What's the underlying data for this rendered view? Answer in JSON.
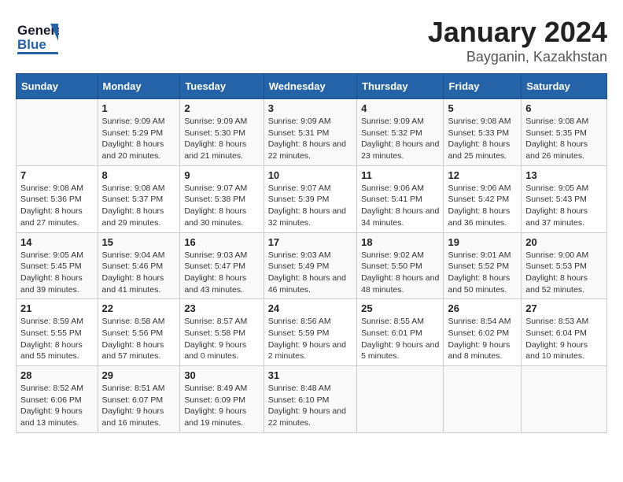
{
  "logo": {
    "line1": "General",
    "line2": "Blue"
  },
  "title": "January 2024",
  "subtitle": "Bayganin, Kazakhstan",
  "days_of_week": [
    "Sunday",
    "Monday",
    "Tuesday",
    "Wednesday",
    "Thursday",
    "Friday",
    "Saturday"
  ],
  "weeks": [
    [
      {
        "day": "",
        "sunrise": "",
        "sunset": "",
        "daylight": ""
      },
      {
        "day": "1",
        "sunrise": "Sunrise: 9:09 AM",
        "sunset": "Sunset: 5:29 PM",
        "daylight": "Daylight: 8 hours and 20 minutes."
      },
      {
        "day": "2",
        "sunrise": "Sunrise: 9:09 AM",
        "sunset": "Sunset: 5:30 PM",
        "daylight": "Daylight: 8 hours and 21 minutes."
      },
      {
        "day": "3",
        "sunrise": "Sunrise: 9:09 AM",
        "sunset": "Sunset: 5:31 PM",
        "daylight": "Daylight: 8 hours and 22 minutes."
      },
      {
        "day": "4",
        "sunrise": "Sunrise: 9:09 AM",
        "sunset": "Sunset: 5:32 PM",
        "daylight": "Daylight: 8 hours and 23 minutes."
      },
      {
        "day": "5",
        "sunrise": "Sunrise: 9:08 AM",
        "sunset": "Sunset: 5:33 PM",
        "daylight": "Daylight: 8 hours and 25 minutes."
      },
      {
        "day": "6",
        "sunrise": "Sunrise: 9:08 AM",
        "sunset": "Sunset: 5:35 PM",
        "daylight": "Daylight: 8 hours and 26 minutes."
      }
    ],
    [
      {
        "day": "7",
        "sunrise": "Sunrise: 9:08 AM",
        "sunset": "Sunset: 5:36 PM",
        "daylight": "Daylight: 8 hours and 27 minutes."
      },
      {
        "day": "8",
        "sunrise": "Sunrise: 9:08 AM",
        "sunset": "Sunset: 5:37 PM",
        "daylight": "Daylight: 8 hours and 29 minutes."
      },
      {
        "day": "9",
        "sunrise": "Sunrise: 9:07 AM",
        "sunset": "Sunset: 5:38 PM",
        "daylight": "Daylight: 8 hours and 30 minutes."
      },
      {
        "day": "10",
        "sunrise": "Sunrise: 9:07 AM",
        "sunset": "Sunset: 5:39 PM",
        "daylight": "Daylight: 8 hours and 32 minutes."
      },
      {
        "day": "11",
        "sunrise": "Sunrise: 9:06 AM",
        "sunset": "Sunset: 5:41 PM",
        "daylight": "Daylight: 8 hours and 34 minutes."
      },
      {
        "day": "12",
        "sunrise": "Sunrise: 9:06 AM",
        "sunset": "Sunset: 5:42 PM",
        "daylight": "Daylight: 8 hours and 36 minutes."
      },
      {
        "day": "13",
        "sunrise": "Sunrise: 9:05 AM",
        "sunset": "Sunset: 5:43 PM",
        "daylight": "Daylight: 8 hours and 37 minutes."
      }
    ],
    [
      {
        "day": "14",
        "sunrise": "Sunrise: 9:05 AM",
        "sunset": "Sunset: 5:45 PM",
        "daylight": "Daylight: 8 hours and 39 minutes."
      },
      {
        "day": "15",
        "sunrise": "Sunrise: 9:04 AM",
        "sunset": "Sunset: 5:46 PM",
        "daylight": "Daylight: 8 hours and 41 minutes."
      },
      {
        "day": "16",
        "sunrise": "Sunrise: 9:03 AM",
        "sunset": "Sunset: 5:47 PM",
        "daylight": "Daylight: 8 hours and 43 minutes."
      },
      {
        "day": "17",
        "sunrise": "Sunrise: 9:03 AM",
        "sunset": "Sunset: 5:49 PM",
        "daylight": "Daylight: 8 hours and 46 minutes."
      },
      {
        "day": "18",
        "sunrise": "Sunrise: 9:02 AM",
        "sunset": "Sunset: 5:50 PM",
        "daylight": "Daylight: 8 hours and 48 minutes."
      },
      {
        "day": "19",
        "sunrise": "Sunrise: 9:01 AM",
        "sunset": "Sunset: 5:52 PM",
        "daylight": "Daylight: 8 hours and 50 minutes."
      },
      {
        "day": "20",
        "sunrise": "Sunrise: 9:00 AM",
        "sunset": "Sunset: 5:53 PM",
        "daylight": "Daylight: 8 hours and 52 minutes."
      }
    ],
    [
      {
        "day": "21",
        "sunrise": "Sunrise: 8:59 AM",
        "sunset": "Sunset: 5:55 PM",
        "daylight": "Daylight: 8 hours and 55 minutes."
      },
      {
        "day": "22",
        "sunrise": "Sunrise: 8:58 AM",
        "sunset": "Sunset: 5:56 PM",
        "daylight": "Daylight: 8 hours and 57 minutes."
      },
      {
        "day": "23",
        "sunrise": "Sunrise: 8:57 AM",
        "sunset": "Sunset: 5:58 PM",
        "daylight": "Daylight: 9 hours and 0 minutes."
      },
      {
        "day": "24",
        "sunrise": "Sunrise: 8:56 AM",
        "sunset": "Sunset: 5:59 PM",
        "daylight": "Daylight: 9 hours and 2 minutes."
      },
      {
        "day": "25",
        "sunrise": "Sunrise: 8:55 AM",
        "sunset": "Sunset: 6:01 PM",
        "daylight": "Daylight: 9 hours and 5 minutes."
      },
      {
        "day": "26",
        "sunrise": "Sunrise: 8:54 AM",
        "sunset": "Sunset: 6:02 PM",
        "daylight": "Daylight: 9 hours and 8 minutes."
      },
      {
        "day": "27",
        "sunrise": "Sunrise: 8:53 AM",
        "sunset": "Sunset: 6:04 PM",
        "daylight": "Daylight: 9 hours and 10 minutes."
      }
    ],
    [
      {
        "day": "28",
        "sunrise": "Sunrise: 8:52 AM",
        "sunset": "Sunset: 6:06 PM",
        "daylight": "Daylight: 9 hours and 13 minutes."
      },
      {
        "day": "29",
        "sunrise": "Sunrise: 8:51 AM",
        "sunset": "Sunset: 6:07 PM",
        "daylight": "Daylight: 9 hours and 16 minutes."
      },
      {
        "day": "30",
        "sunrise": "Sunrise: 8:49 AM",
        "sunset": "Sunset: 6:09 PM",
        "daylight": "Daylight: 9 hours and 19 minutes."
      },
      {
        "day": "31",
        "sunrise": "Sunrise: 8:48 AM",
        "sunset": "Sunset: 6:10 PM",
        "daylight": "Daylight: 9 hours and 22 minutes."
      },
      {
        "day": "",
        "sunrise": "",
        "sunset": "",
        "daylight": ""
      },
      {
        "day": "",
        "sunrise": "",
        "sunset": "",
        "daylight": ""
      },
      {
        "day": "",
        "sunrise": "",
        "sunset": "",
        "daylight": ""
      }
    ]
  ]
}
